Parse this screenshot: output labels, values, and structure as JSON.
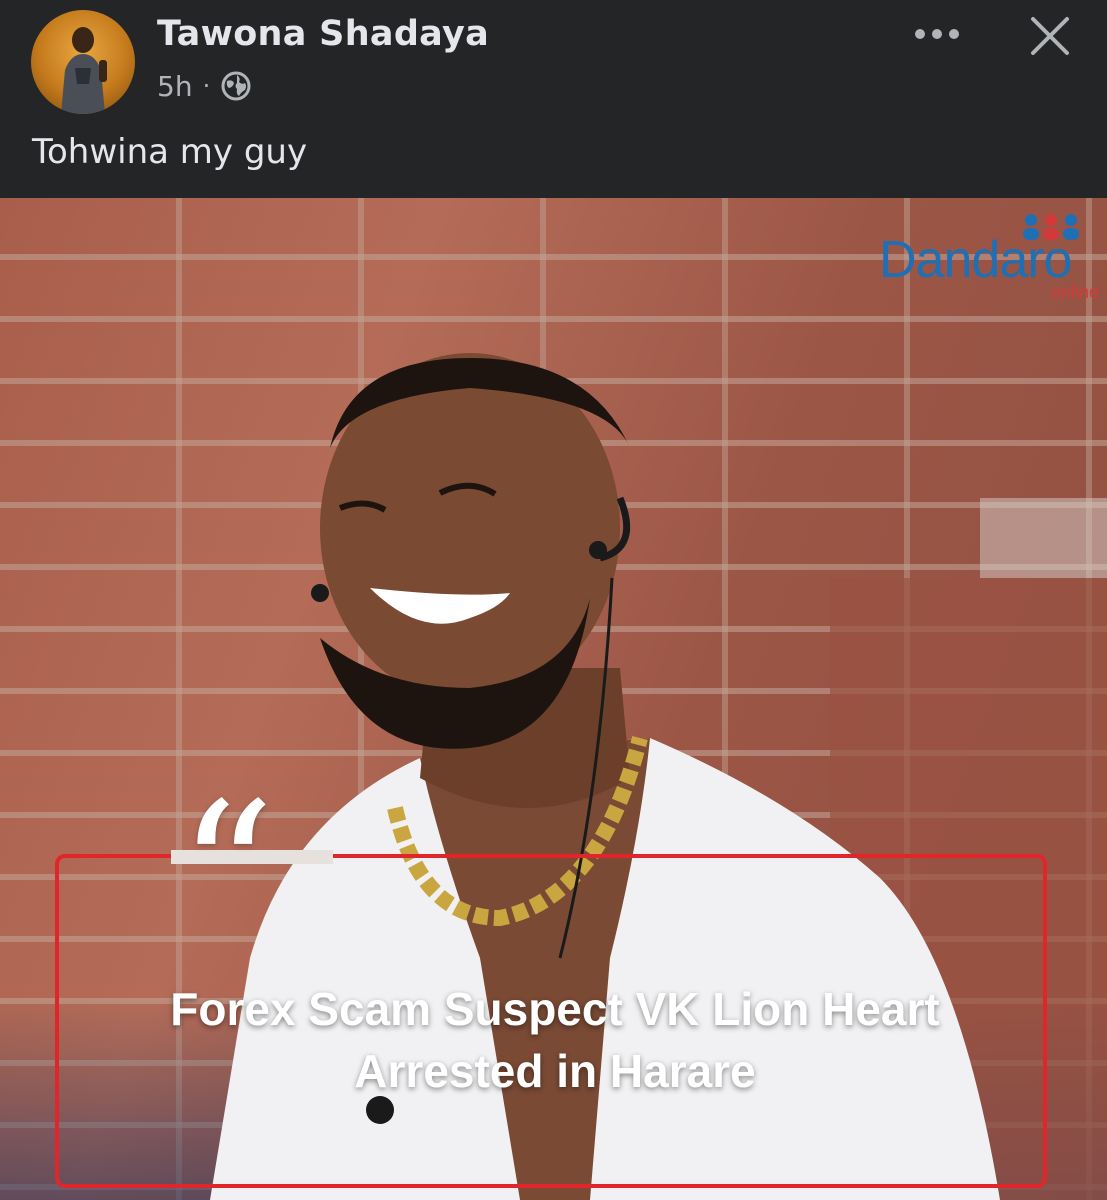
{
  "post": {
    "author": "Tawona Shadaya",
    "time": "5h",
    "separator": "·",
    "audience_icon": "globe-icon",
    "text": "Tohwina my guy",
    "more_icon": "more-horizontal-icon",
    "close_icon": "close-icon"
  },
  "image": {
    "logo_main": "Dandaro",
    "logo_sub": "online",
    "quote_mark": "“",
    "headline_line1": "Forex Scam Suspect VK Lion Heart",
    "headline_line2": "Arrested in Harare"
  },
  "colors": {
    "background": "#242526",
    "text_primary": "#e4e6eb",
    "text_secondary": "#b0b3b8",
    "frame_red": "#e0262b",
    "logo_blue": "#1f6fb5",
    "logo_red": "#d23a3a"
  }
}
